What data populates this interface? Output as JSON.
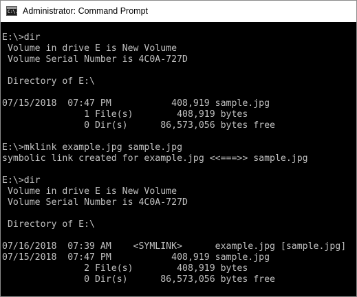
{
  "window": {
    "title": "Administrator: Command Prompt",
    "icon": "command-prompt-icon",
    "icon_glyph": "C:\\."
  },
  "colors": {
    "console_background": "#000000",
    "console_text": "#c0c0c0",
    "titlebar_background": "#ffffff",
    "title_text": "#000000"
  },
  "console": {
    "lines": [
      "E:\\>dir",
      " Volume in drive E is New Volume",
      " Volume Serial Number is 4C0A-727D",
      "",
      " Directory of E:\\",
      "",
      "07/15/2018  07:47 PM           408,919 sample.jpg",
      "               1 File(s)        408,919 bytes",
      "               0 Dir(s)      86,573,056 bytes free",
      "",
      "E:\\>mklink example.jpg sample.jpg",
      "symbolic link created for example.jpg <<===>> sample.jpg",
      "",
      "E:\\>dir",
      " Volume in drive E is New Volume",
      " Volume Serial Number is 4C0A-727D",
      "",
      " Directory of E:\\",
      "",
      "07/16/2018  07:39 AM    <SYMLINK>      example.jpg [sample.jpg]",
      "07/15/2018  07:47 PM           408,919 sample.jpg",
      "               2 File(s)        408,919 bytes",
      "               0 Dir(s)      86,573,056 bytes free"
    ]
  }
}
